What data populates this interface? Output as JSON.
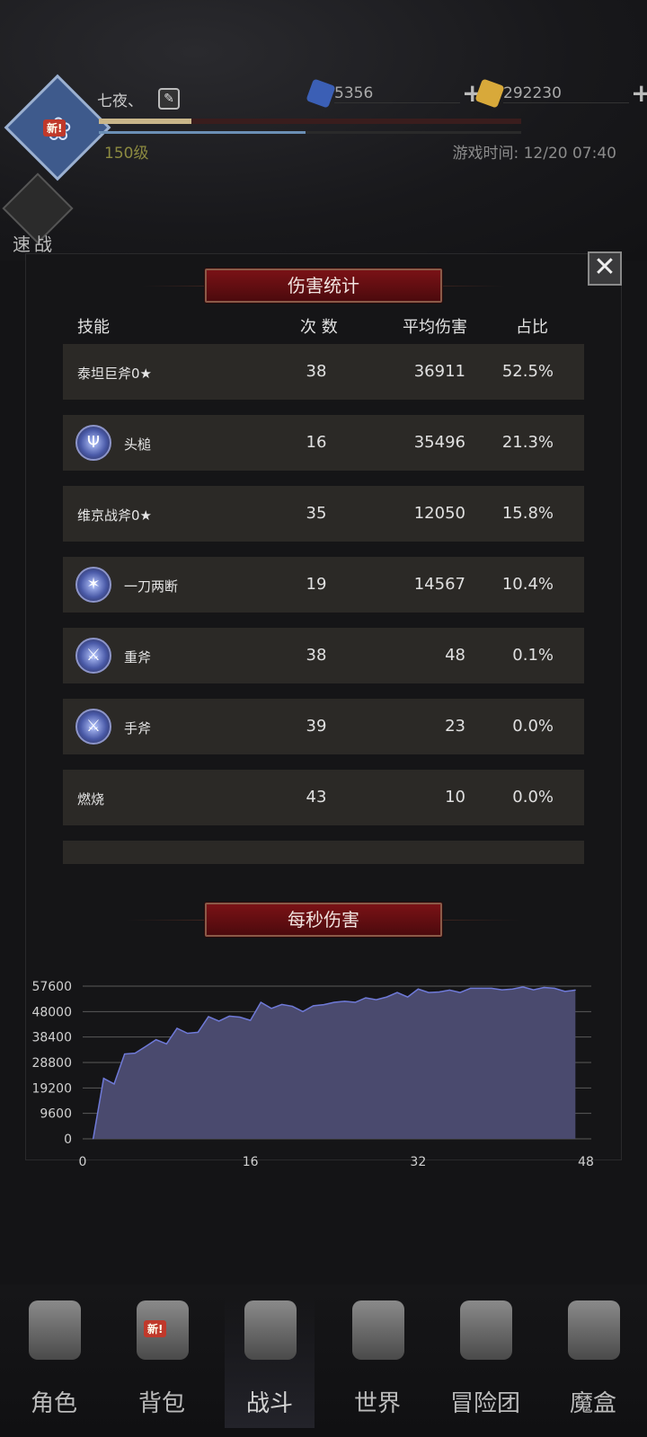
{
  "header": {
    "player_name": "七夜、",
    "avatar_badge": "新!",
    "level": "150级",
    "game_time": "游戏时间: 12/20 07:40",
    "gems": "5356",
    "gold": "292230",
    "exp_progress": 0.22,
    "mp_progress": 0.49,
    "gem_color": "#3b5fb5",
    "gold_color": "#d8a93a"
  },
  "quick_battle": {
    "label": "速战"
  },
  "damage_stats": {
    "title": "伤害统计",
    "columns": {
      "skill": "技能",
      "count": "次 数",
      "avg": "平均伤害",
      "pct": "占比"
    },
    "rows": [
      {
        "name": "泰坦巨斧0★",
        "icon": "",
        "count": "38",
        "avg": "36911",
        "pct": "52.5%"
      },
      {
        "name": "头槌",
        "icon": "headbutt-skill-icon",
        "count": "16",
        "avg": "35496",
        "pct": "21.3%"
      },
      {
        "name": "维京战斧0★",
        "icon": "",
        "count": "35",
        "avg": "12050",
        "pct": "15.8%"
      },
      {
        "name": "一刀两断",
        "icon": "cleave-skill-icon",
        "count": "19",
        "avg": "14567",
        "pct": "10.4%"
      },
      {
        "name": "重斧",
        "icon": "heavy-axe-skill-icon",
        "count": "38",
        "avg": "48",
        "pct": "0.1%"
      },
      {
        "name": "手斧",
        "icon": "hand-axe-skill-icon",
        "count": "39",
        "avg": "23",
        "pct": "0.0%"
      },
      {
        "name": "燃烧",
        "icon": "",
        "count": "43",
        "avg": "10",
        "pct": "0.0%"
      }
    ]
  },
  "dps": {
    "title": "每秒伤害"
  },
  "chart_data": {
    "type": "area",
    "title": "每秒伤害",
    "xlabel": "",
    "ylabel": "",
    "x_ticks": [
      "0",
      "16",
      "32",
      "48"
    ],
    "y_ticks": [
      "57600",
      "48000",
      "38400",
      "28800",
      "19200",
      "9600",
      "0"
    ],
    "xlim": [
      0,
      48
    ],
    "ylim": [
      0,
      57600
    ],
    "grid": true,
    "fill_color": "#4a4a6e",
    "line_color": "#6f7ad8",
    "x": [
      1,
      2,
      3,
      4,
      5,
      6,
      7,
      8,
      9,
      10,
      11,
      12,
      13,
      14,
      15,
      16,
      17,
      18,
      19,
      20,
      21,
      22,
      23,
      24,
      25,
      26,
      27,
      28,
      29,
      30,
      31,
      32,
      33,
      34,
      35,
      36,
      37,
      38,
      39,
      40,
      41,
      42,
      43,
      44,
      45,
      46,
      47
    ],
    "values": [
      0,
      22800,
      20700,
      32000,
      32300,
      34800,
      37400,
      35800,
      41700,
      39800,
      40200,
      46100,
      44400,
      46300,
      45900,
      44700,
      51500,
      49200,
      50700,
      50000,
      48000,
      50200,
      50600,
      51500,
      51900,
      51500,
      53200,
      52500,
      53500,
      55200,
      53500,
      56500,
      55200,
      55400,
      56100,
      55200,
      56800,
      56800,
      56800,
      56200,
      56500,
      57300,
      56200,
      57100,
      56800,
      55600,
      56100
    ]
  },
  "nav": [
    {
      "id": "character",
      "label": "角色"
    },
    {
      "id": "bag",
      "label": "背包",
      "badge": "新!"
    },
    {
      "id": "battle",
      "label": "战斗",
      "active": true
    },
    {
      "id": "world",
      "label": "世界"
    },
    {
      "id": "guild",
      "label": "冒险团"
    },
    {
      "id": "magicbox",
      "label": "魔盒"
    }
  ]
}
